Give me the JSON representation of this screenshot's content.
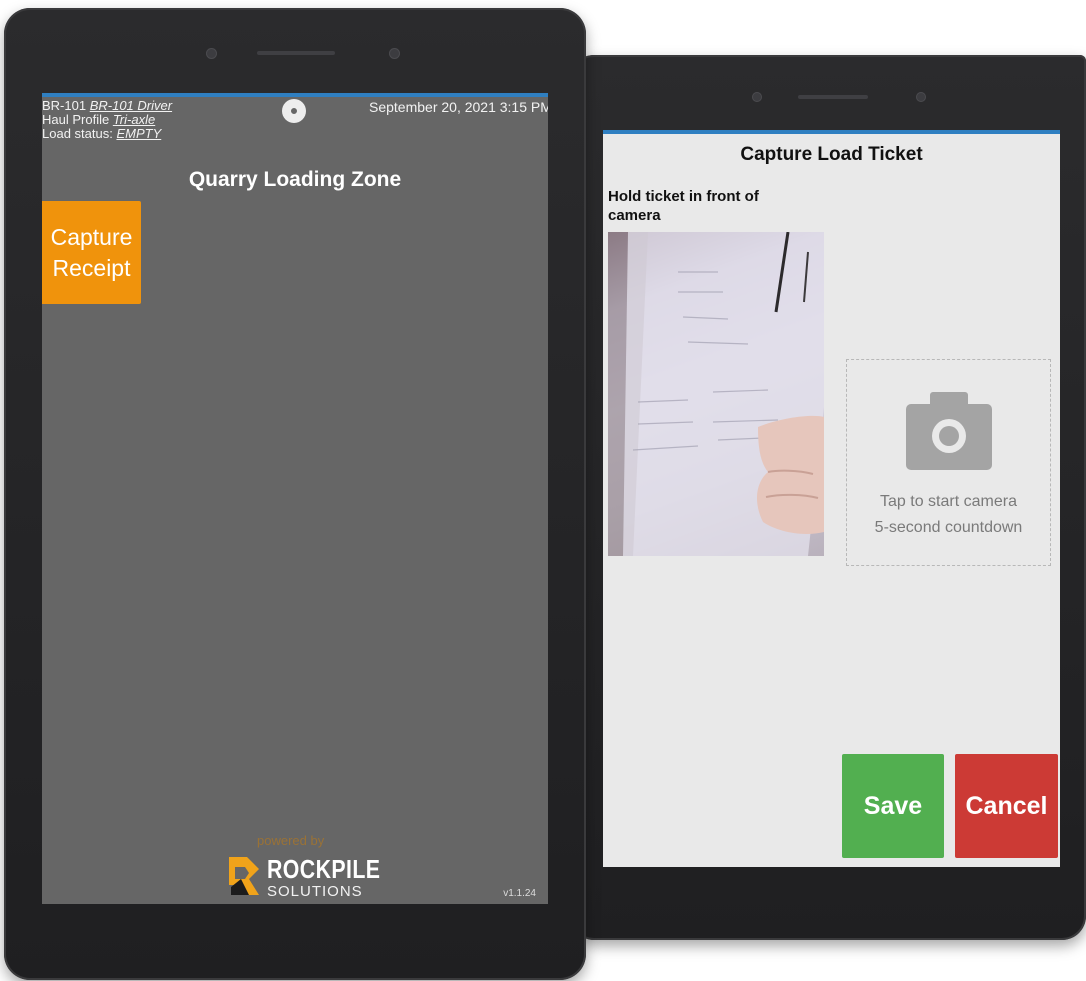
{
  "left_screen": {
    "status": {
      "truck_id": "BR-101",
      "driver": "BR-101 Driver",
      "haul_profile_label": "Haul Profile",
      "haul_profile": "Tri-axle",
      "load_status_label": "Load status:",
      "load_status": "EMPTY"
    },
    "datetime": "September 20, 2021 3:15 PM",
    "zone_title": "Quarry Loading Zone",
    "capture_button": {
      "line1": "Capture",
      "line2": "Receipt"
    },
    "footer": {
      "powered_by": "powered by",
      "brand": "ROCKPILE",
      "brand_sub": "SOLUTIONS",
      "version": "v1.1.24"
    }
  },
  "right_screen": {
    "title": "Capture Load Ticket",
    "hint": "Hold ticket in front of camera",
    "camera_box": {
      "line1": "Tap to start camera",
      "line2": "5-second countdown"
    },
    "save_label": "Save",
    "cancel_label": "Cancel"
  },
  "colors": {
    "accent_bar": "#2f7fc1",
    "capture_button": "#f0930c",
    "save_button": "#52af50",
    "cancel_button": "#cc3a35"
  }
}
